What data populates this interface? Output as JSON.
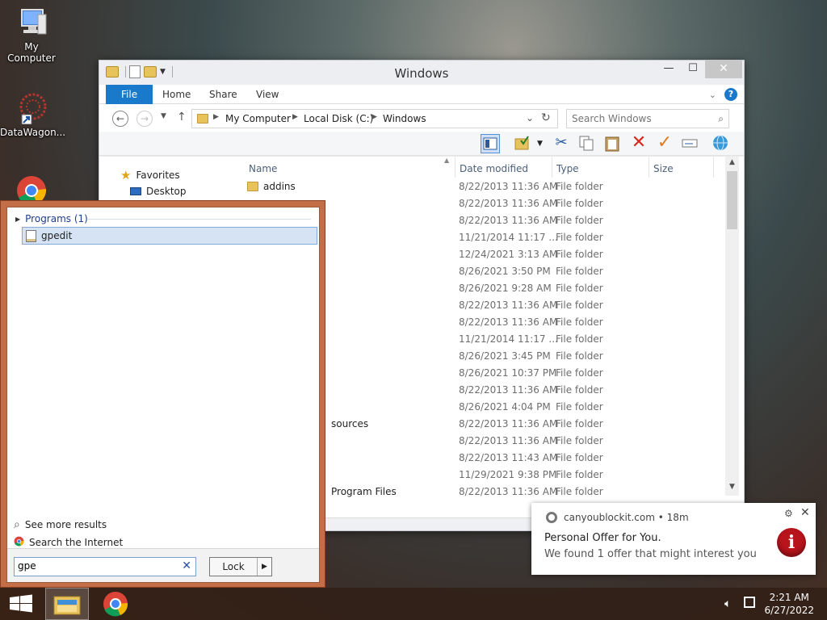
{
  "desktop": {
    "icons": [
      {
        "label": "My Computer",
        "icon": "computer-icon"
      },
      {
        "label": "DataWagon...",
        "icon": "datawagon-shortcut-icon"
      },
      {
        "label": "",
        "icon": "chrome-icon"
      }
    ]
  },
  "explorer": {
    "title": "Windows",
    "ribbon_tabs": [
      "File",
      "Home",
      "Share",
      "View"
    ],
    "breadcrumb": [
      "My Computer",
      "Local Disk (C:)",
      "Windows"
    ],
    "search_placeholder": "Search Windows",
    "nav_pane": [
      {
        "label": "Favorites",
        "icon": "star-icon"
      },
      {
        "label": "Desktop",
        "icon": "desktop-folder-icon"
      }
    ],
    "columns": [
      "Name",
      "Date modified",
      "Type",
      "Size"
    ],
    "rows": [
      {
        "name": "addins",
        "date": "8/22/2013 11:36 AM",
        "type": "File folder"
      },
      {
        "name": "",
        "date": "8/22/2013 11:36 AM",
        "type": "File folder"
      },
      {
        "name": "",
        "date": "8/22/2013 11:36 AM",
        "type": "File folder"
      },
      {
        "name": "",
        "date": "11/21/2014 11:17 ...",
        "type": "File folder"
      },
      {
        "name": "",
        "date": "12/24/2021 3:13 AM",
        "type": "File folder"
      },
      {
        "name": "",
        "date": "8/26/2021 3:50 PM",
        "type": "File folder"
      },
      {
        "name": "",
        "date": "8/26/2021 9:28 AM",
        "type": "File folder"
      },
      {
        "name": "",
        "date": "8/22/2013 11:36 AM",
        "type": "File folder"
      },
      {
        "name": "",
        "date": "8/22/2013 11:36 AM",
        "type": "File folder"
      },
      {
        "name": "",
        "date": "11/21/2014 11:17 ...",
        "type": "File folder"
      },
      {
        "name": "",
        "date": "8/26/2021 3:45 PM",
        "type": "File folder"
      },
      {
        "name": "",
        "date": "8/26/2021 10:37 PM",
        "type": "File folder"
      },
      {
        "name": "",
        "date": "8/22/2013 11:36 AM",
        "type": "File folder"
      },
      {
        "name": "",
        "date": "8/26/2021 4:04 PM",
        "type": "File folder"
      },
      {
        "name": "sources",
        "date": "8/22/2013 11:36 AM",
        "type": "File folder"
      },
      {
        "name": "",
        "date": "8/22/2013 11:36 AM",
        "type": "File folder"
      },
      {
        "name": "",
        "date": "8/22/2013 11:43 AM",
        "type": "File folder"
      },
      {
        "name": "",
        "date": "11/29/2021 9:38 PM",
        "type": "File folder"
      },
      {
        "name": "Program Files",
        "date": "8/22/2013 11:36 AM",
        "type": "File folder"
      }
    ]
  },
  "start_search": {
    "group_label": "Programs (1)",
    "result": "gpedit",
    "see_more": "See more results",
    "search_internet": "Search the Internet",
    "query": "gpe",
    "lock_label": "Lock"
  },
  "notification": {
    "source": "canyoublockit.com",
    "age": "18m",
    "title": "Personal Offer for You.",
    "message": "We found 1 offer that might interest you"
  },
  "taskbar": {
    "time": "2:21 AM",
    "date": "6/27/2022"
  },
  "colors": {
    "ribbon_file_tab": "#1979ca",
    "startmenu_border": "#c46e48",
    "selected_result": "#d5e3f5"
  }
}
